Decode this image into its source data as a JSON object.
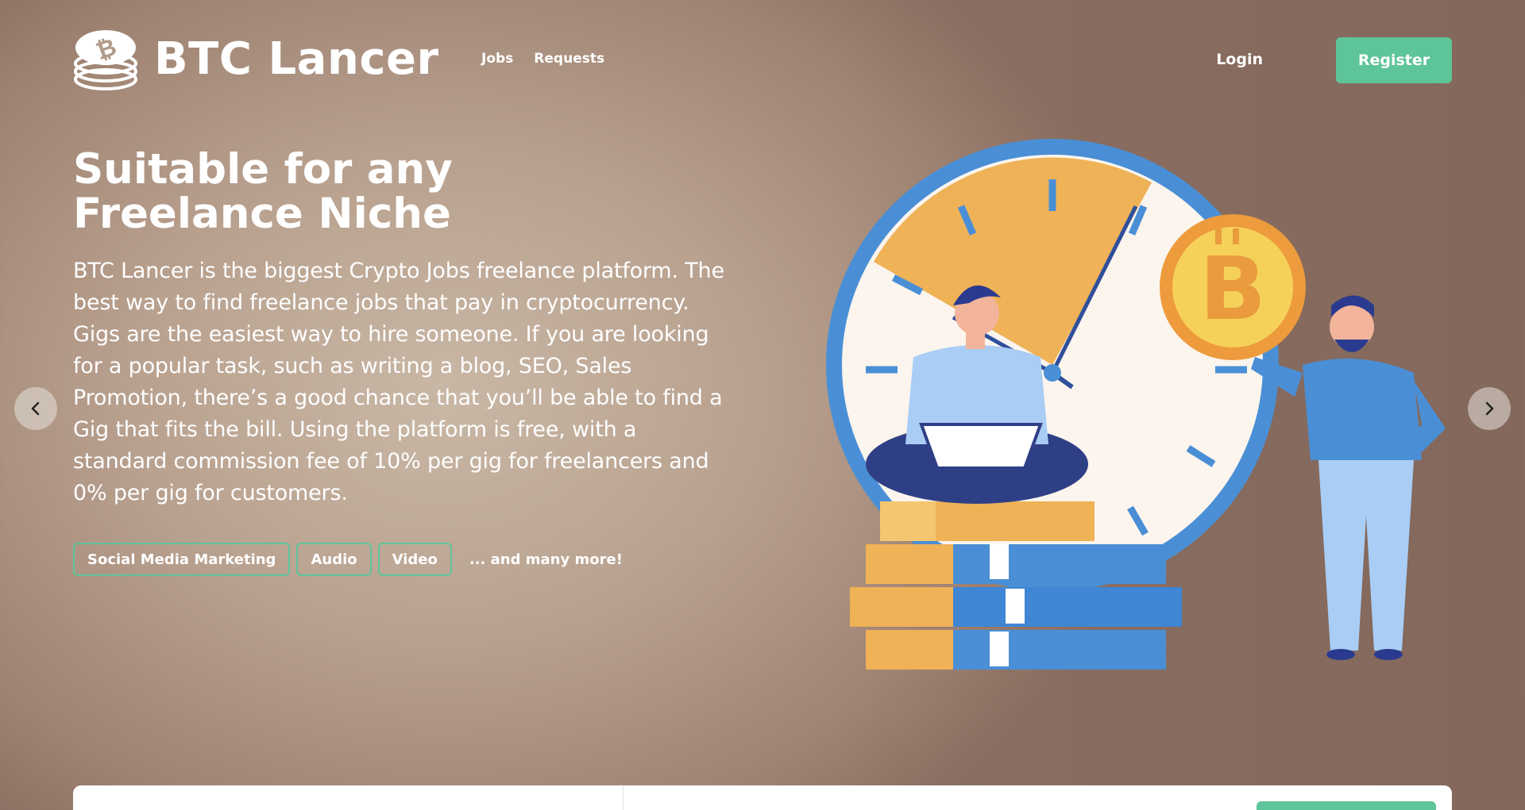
{
  "brand": {
    "name": "BTC Lancer",
    "logo_icon": "bitcoin-coin-stack-icon"
  },
  "nav": {
    "items": [
      {
        "label": "Jobs"
      },
      {
        "label": "Requests"
      }
    ]
  },
  "auth": {
    "login_label": "Login",
    "register_label": "Register"
  },
  "hero": {
    "title": "Suitable for any Freelance Niche",
    "description": "BTC Lancer is the biggest Crypto Jobs freelance platform. The best way to find freelance jobs that pay in cryptocurrency. Gigs are the easiest way to hire someone. If you are looking for a popular task, such as writing a blog, SEO, Sales Promotion, there’s a good chance that you’ll be able to find a Gig that fits the bill. Using the platform is free, with a standard commission fee of 10% per gig for freelancers and 0% per gig for customers.",
    "tags": [
      "Social Media Marketing",
      "Audio",
      "Video"
    ],
    "more_label": "... and many more!"
  },
  "carousel": {
    "prev_icon": "chevron-left-icon",
    "next_icon": "chevron-right-icon"
  },
  "colors": {
    "accent": "#5ec49a",
    "clock_blue": "#4a90d9",
    "coin_orange": "#f0a94a"
  }
}
